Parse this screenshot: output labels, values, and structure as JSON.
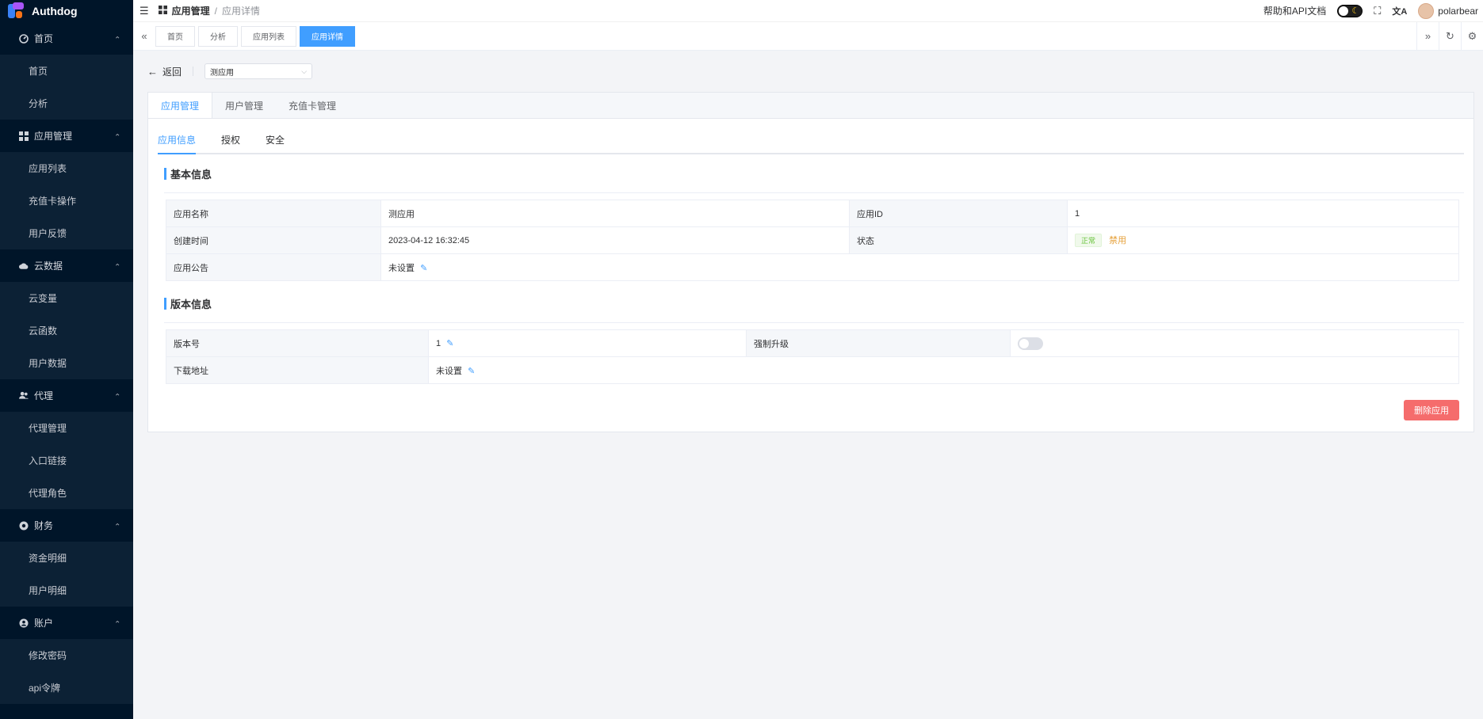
{
  "app": {
    "logo_text": "Authdog"
  },
  "sidebar": {
    "groups": [
      {
        "label": "首页",
        "icon": "dashboard-icon",
        "items": [
          "首页",
          "分析"
        ]
      },
      {
        "label": "应用管理",
        "icon": "grid-icon",
        "items": [
          "应用列表",
          "充值卡操作",
          "用户反馈"
        ]
      },
      {
        "label": "云数据",
        "icon": "cloud-icon",
        "items": [
          "云变量",
          "云函数",
          "用户数据"
        ]
      },
      {
        "label": "代理",
        "icon": "users-icon",
        "items": [
          "代理管理",
          "入口链接",
          "代理角色"
        ]
      },
      {
        "label": "财务",
        "icon": "finance-icon",
        "items": [
          "资金明细",
          "用户明细"
        ]
      },
      {
        "label": "账户",
        "icon": "account-icon",
        "items": [
          "修改密码",
          "api令牌"
        ]
      }
    ]
  },
  "header": {
    "breadcrumb": {
      "parent": "应用管理",
      "separator": "/",
      "current": "应用详情"
    },
    "help_label": "帮助和API文档",
    "username": "polarbear"
  },
  "tabbar": {
    "tabs": [
      "首页",
      "分析",
      "应用列表",
      "应用详情"
    ],
    "active_index": 3
  },
  "page": {
    "back_label": "返回",
    "app_select": {
      "value": "测应用"
    },
    "main_tabs": [
      "应用管理",
      "用户管理",
      "充值卡管理"
    ],
    "sub_tabs": [
      "应用信息",
      "授权",
      "安全"
    ],
    "basic": {
      "title": "基本信息",
      "app_name_label": "应用名称",
      "app_name": "测应用",
      "app_id_label": "应用ID",
      "app_id": "1",
      "created_label": "创建时间",
      "created": "2023-04-12 16:32:45",
      "status_label": "状态",
      "status_tag": "正常",
      "status_action": "禁用",
      "notice_label": "应用公告",
      "notice": "未设置"
    },
    "version": {
      "title": "版本信息",
      "version_label": "版本号",
      "version": "1",
      "force_label": "强制升级",
      "force_enabled": false,
      "download_label": "下载地址",
      "download": "未设置"
    },
    "delete_label": "删除应用"
  },
  "colors": {
    "sidebar_bg": "#001529",
    "primary": "#409eff",
    "danger": "#f56c6c",
    "success": "#67c23a",
    "warning": "#e6a23c"
  }
}
